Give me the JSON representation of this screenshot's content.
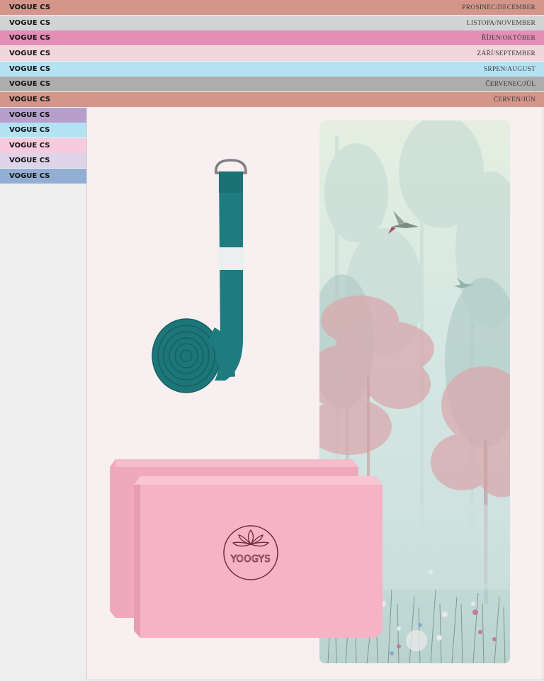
{
  "brand": "VOGUE CS",
  "issues": [
    {
      "brand": "VOGUE CS",
      "month": "PROSINEC/DECEMBER",
      "color": "#d4968a"
    },
    {
      "brand": "VOGUE CS",
      "month": "LISTOPA/NOVEMBER",
      "color": "#d3d3d5"
    },
    {
      "brand": "VOGUE CS",
      "month": "ŘÍJEN/OKTÓBER",
      "color": "#e38db7"
    },
    {
      "brand": "VOGUE CS",
      "month": "ZÁŘÍ/SEPTEMBER",
      "color": "#f1d6db"
    },
    {
      "brand": "VOGUE CS",
      "month": "SRPEN/AUGUST",
      "color": "#b3e2f3"
    },
    {
      "brand": "VOGUE CS",
      "month": "ČERVENEC/JÚL",
      "color": "#adadad"
    },
    {
      "brand": "VOGUE CS",
      "month": "ČERVEN/JÚN",
      "color": "#d4968a"
    }
  ],
  "side_issues": [
    {
      "brand": "VOGUE CS",
      "color": "#b6a0cb"
    },
    {
      "brand": "VOGUE CS",
      "color": "#b3e2f3"
    },
    {
      "brand": "VOGUE CS",
      "color": "#f7cbdd"
    },
    {
      "brand": "VOGUE CS",
      "color": "#ddd4ea"
    },
    {
      "brand": "VOGUE CS",
      "color": "#93aed4"
    }
  ],
  "product": {
    "block_logo_text": "YOOGYS",
    "items": [
      "yoga-strap",
      "yoga-blocks",
      "yoga-mat"
    ]
  }
}
